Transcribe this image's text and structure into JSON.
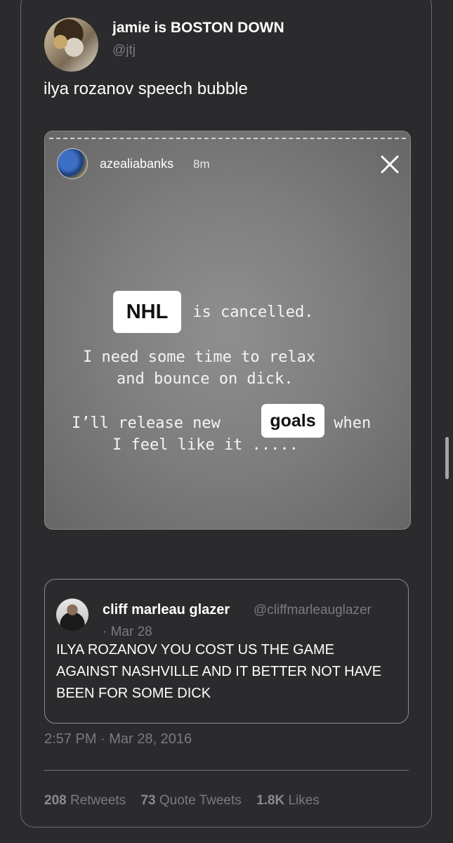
{
  "author": {
    "display_name": "jamie is BOSTON DOWN",
    "handle": "@jtj",
    "avatar_icon": "hockey-bear-avatar"
  },
  "tweet_text": "ilya rozanov speech bubble",
  "story": {
    "username": "azealiabanks",
    "time": "8m",
    "close_icon": "close-icon",
    "box1": "NHL",
    "line1": " is cancelled.",
    "line2": "I need some time to relax",
    "line3": "and bounce on dick.",
    "line4a": "I’ll release new",
    "box2": "goals",
    "line4b": " when",
    "line5": "I feel like it ....."
  },
  "quote": {
    "display_name": "cliff marleau glazer",
    "handle": "@cliffmarleauglazer",
    "date": "· Mar 28",
    "text": "ILYA ROZANOV YOU COST US THE GAME AGAINST NASHVILLE AND IT BETTER NOT HAVE BEEN FOR SOME DICK"
  },
  "timestamp": "2:57 PM · Mar 28, 2016",
  "stats": {
    "retweets_count": "208",
    "retweets_label": "Retweets",
    "quotes_count": "73",
    "quotes_label": "Quote Tweets",
    "likes_count": "1.8K",
    "likes_label": "Likes"
  }
}
